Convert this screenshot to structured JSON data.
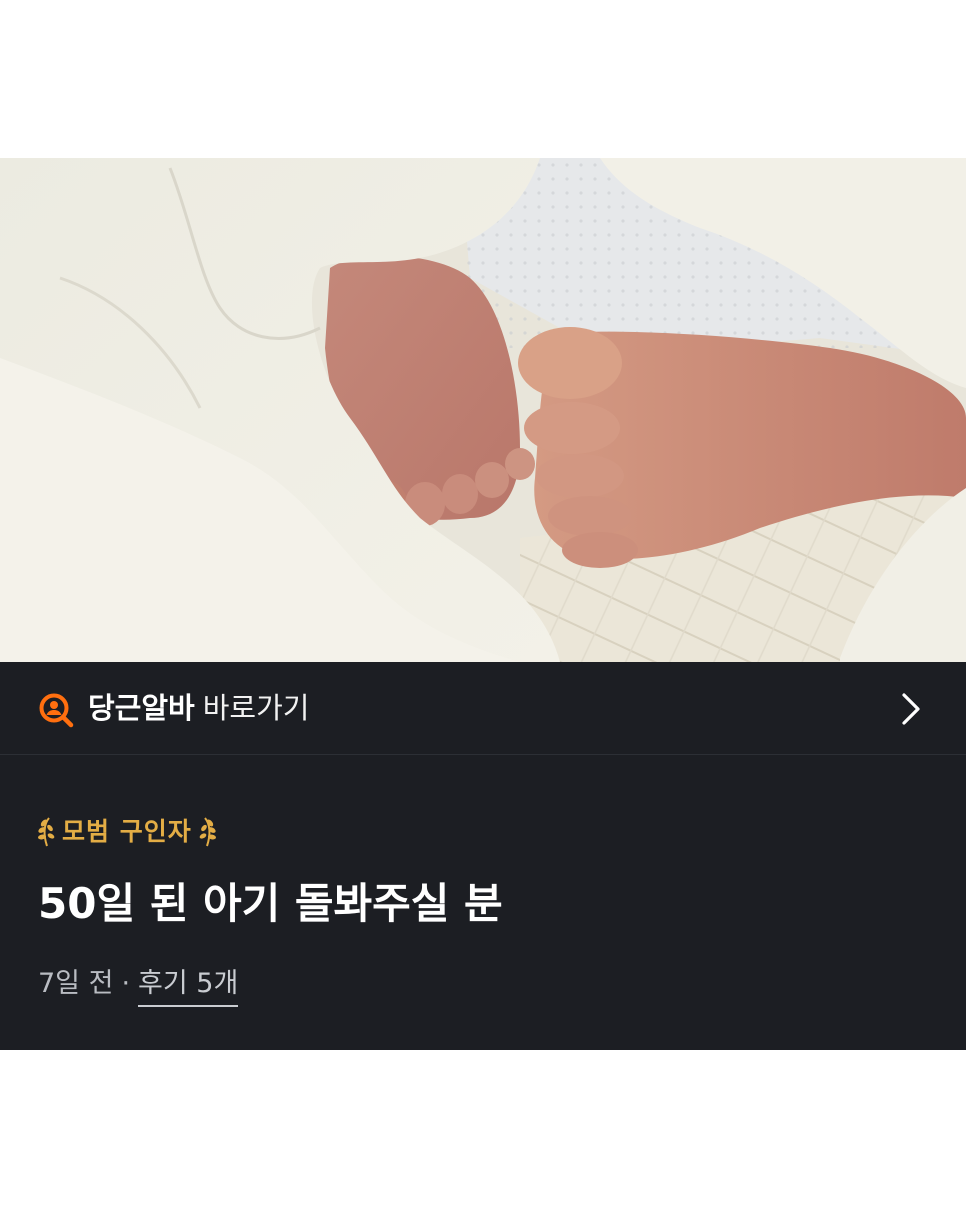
{
  "photo": {
    "subject": "baby-feet-under-blanket",
    "colors": {
      "blanket": "#f1eee3",
      "skin": "#c98a78"
    }
  },
  "shortcut": {
    "brand": "당근알바",
    "action": "바로가기",
    "icon": "search-person-icon",
    "brand_color": "#ff6f0f",
    "chevron_icon": "chevron-right-icon"
  },
  "post": {
    "badge": "모범 구인자",
    "badge_color": "#e3ad45",
    "title": "50일 된 아기 돌봐주실 분",
    "time_ago": "7일 전",
    "separator": "·",
    "reviews_label": "후기 5개"
  },
  "theme": {
    "panel_bg": "#1c1e23",
    "page_bg": "#ffffff"
  }
}
